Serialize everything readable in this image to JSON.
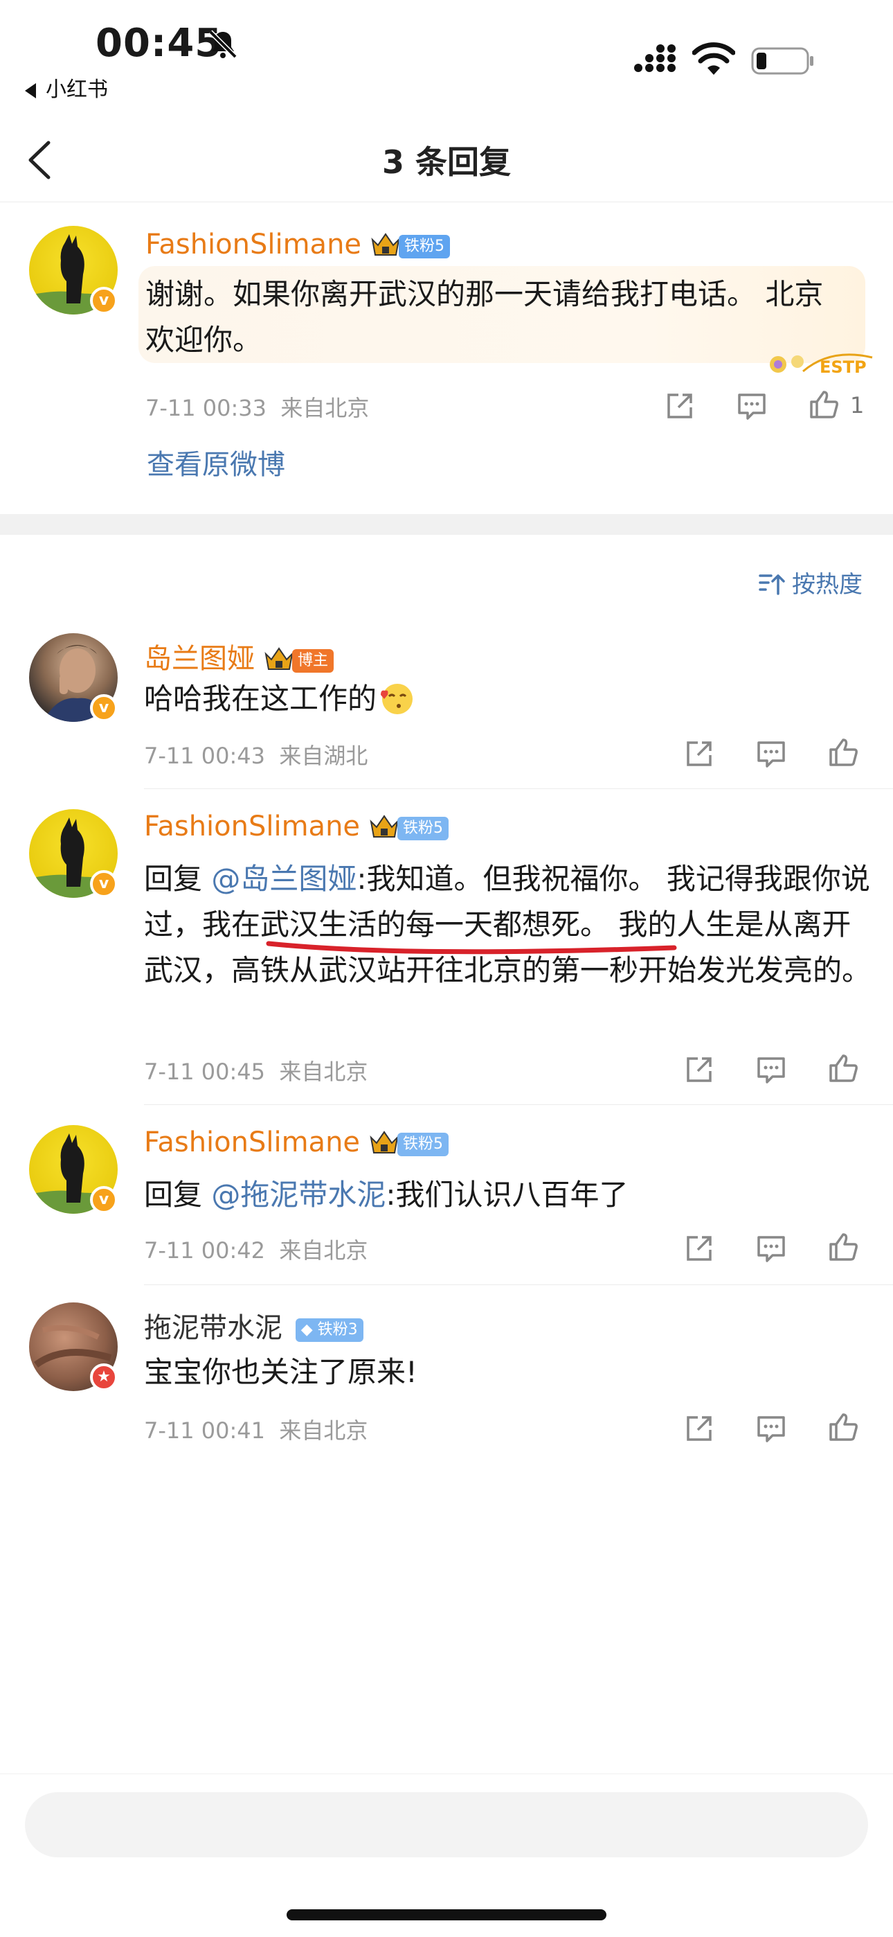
{
  "status_bar": {
    "time": "00:45",
    "back_app": "小红书"
  },
  "nav": {
    "title": "3 条回复"
  },
  "main_comment": {
    "user": "FashionSlimane",
    "badge": "铁粉5",
    "text": "谢谢。如果你离开武汉的那一天请给我打电话。 北京欢迎你。",
    "time": "7-11 00:33",
    "location": "来自北京",
    "like_count": "1",
    "view_original": "查看原微博",
    "sticker_text": "ESTP"
  },
  "sort": {
    "label": "按热度"
  },
  "replies": [
    {
      "user": "岛兰图娅",
      "badge": "博主",
      "text": "哈哈我在这工作的",
      "time": "7-11 00:43",
      "location": "来自湖北"
    },
    {
      "user": "FashionSlimane",
      "badge": "铁粉5",
      "reply_prefix": "回复",
      "mention": "@岛兰图娅",
      "text": ":我知道。但我祝福你。 我记得我跟你说过，我在武汉生活的每一天都想死。 我的人生是从离开武汉，高铁从武汉站开往北京的第一秒开始发光发亮的。",
      "time": "7-11 00:45",
      "location": "来自北京"
    },
    {
      "user": "FashionSlimane",
      "badge": "铁粉5",
      "reply_prefix": "回复",
      "mention": "@拖泥带水泥",
      "text": ":我们认识八百年了",
      "time": "7-11 00:42",
      "location": "来自北京"
    },
    {
      "user": "拖泥带水泥",
      "badge": "铁粉3",
      "text": "宝宝你也关注了原来!",
      "time": "7-11 00:41",
      "location": "来自北京"
    }
  ],
  "input": {
    "placeholder": ""
  },
  "colors": {
    "username": "#e87b16",
    "link": "#4a78b0",
    "meta": "#9a9a9a",
    "underline": "#d8222a"
  }
}
